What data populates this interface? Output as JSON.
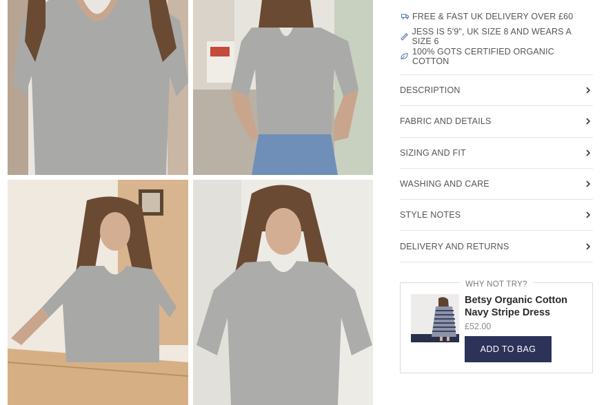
{
  "features": [
    {
      "icon": "delivery-icon",
      "text": "FREE & FAST UK DELIVERY OVER £60"
    },
    {
      "icon": "ruler-icon",
      "text": "JESS IS 5'9\", UK SIZE 8 AND WEARS A SIZE 6"
    },
    {
      "icon": "leaf-icon",
      "text": "100% GOTS CERTIFIED ORGANIC COTTON"
    }
  ],
  "accordion": [
    {
      "label": "DESCRIPTION"
    },
    {
      "label": "FABRIC AND DETAILS"
    },
    {
      "label": "SIZING AND FIT"
    },
    {
      "label": "WASHING AND CARE"
    },
    {
      "label": "STYLE NOTES"
    },
    {
      "label": "DELIVERY AND RETURNS"
    }
  ],
  "upsell": {
    "title": "WHY NOT TRY?",
    "product_name": "Betsy Organic Cotton Navy Stripe Dress",
    "price": "£52.00",
    "button": "ADD TO BAG"
  },
  "colors": {
    "button_bg": "#2c3258",
    "divider": "#e3e3e3",
    "text": "#555555"
  }
}
